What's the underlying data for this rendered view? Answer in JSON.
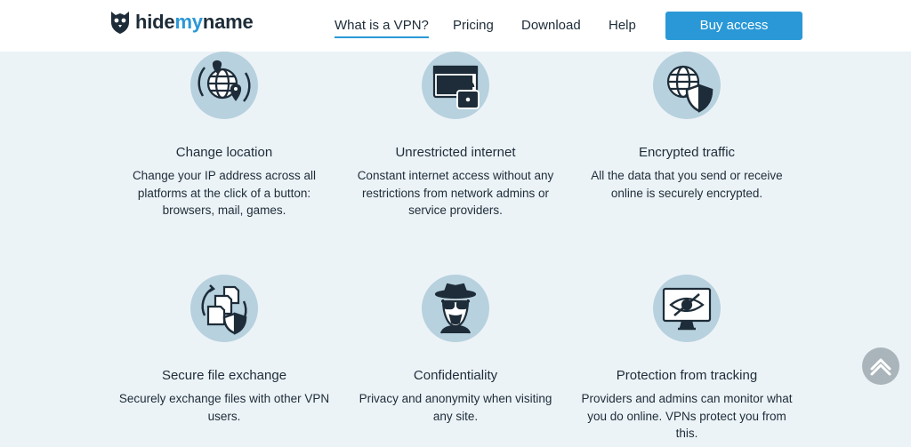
{
  "brand": {
    "name_part1": "hide",
    "name_part2": "my",
    "name_part3": "name",
    "accent_color": "#2a98d6"
  },
  "nav": {
    "items": [
      {
        "label": "What is a VPN?",
        "active": true
      },
      {
        "label": "Pricing"
      },
      {
        "label": "Download"
      },
      {
        "label": "Help"
      }
    ],
    "cta_label": "Buy access"
  },
  "features": [
    {
      "icon": "globe-location-icon",
      "title": "Change location",
      "text": "Change your IP address across all platforms at the click of a button: browsers, mail, games."
    },
    {
      "icon": "browser-lock-icon",
      "title": "Unrestricted internet",
      "text": "Constant internet access without any restrictions from network admins or service providers."
    },
    {
      "icon": "globe-shield-icon",
      "title": "Encrypted traffic",
      "text": "All the data that you send or receive online is securely encrypted."
    },
    {
      "icon": "file-exchange-icon",
      "title": "Secure file exchange",
      "text": "Securely exchange files with other VPN users."
    },
    {
      "icon": "spy-icon",
      "title": "Confidentiality",
      "text": "Privacy and anonymity when visiting any site."
    },
    {
      "icon": "monitor-eye-icon",
      "title": "Protection from tracking",
      "text": "Providers and admins can monitor what you do online. VPNs protect you from this."
    }
  ],
  "colors": {
    "background": "#ecf3f7",
    "icon_circle": "#b7d1de",
    "text": "#1d2c38"
  }
}
